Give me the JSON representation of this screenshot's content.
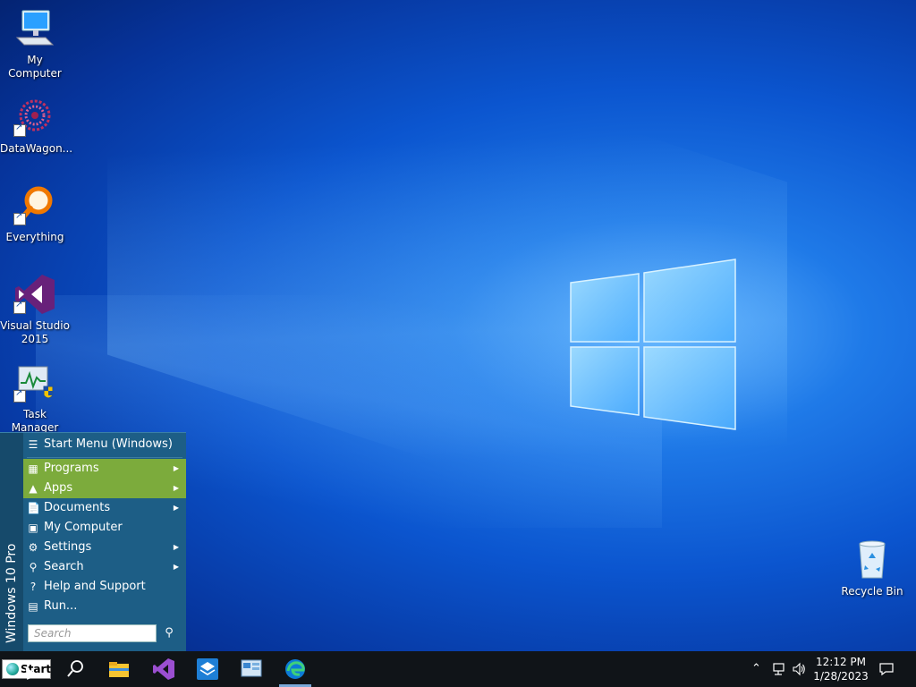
{
  "desktop": {
    "icons": [
      {
        "label": "My Computer"
      },
      {
        "label": "DataWagon..."
      },
      {
        "label": "Everything"
      },
      {
        "label": "Visual Studio 2015"
      },
      {
        "label": "Task Manager"
      },
      {
        "label": "Recycle Bin"
      }
    ]
  },
  "start_menu": {
    "sidebar_text": "Windows 10 Pro",
    "items": [
      {
        "label": "Start Menu (Windows)",
        "icon": "start-menu-icon",
        "submenu": false
      },
      {
        "label": "Programs",
        "icon": "programs-icon",
        "submenu": true
      },
      {
        "label": "Apps",
        "icon": "apps-icon",
        "submenu": true
      },
      {
        "label": "Documents",
        "icon": "documents-icon",
        "submenu": true
      },
      {
        "label": "My Computer",
        "icon": "computer-icon",
        "submenu": false
      },
      {
        "label": "Settings",
        "icon": "settings-icon",
        "submenu": true
      },
      {
        "label": "Search",
        "icon": "search-icon",
        "submenu": true
      },
      {
        "label": "Help and Support",
        "icon": "help-icon",
        "submenu": false
      },
      {
        "label": "Run...",
        "icon": "run-icon",
        "submenu": false
      }
    ],
    "search_placeholder": "Search",
    "highlight_color": "#7cab3c",
    "menu_color": "#1d5e86"
  },
  "taskbar": {
    "start_label": "Start",
    "pinned": [
      "search-icon",
      "file-explorer-icon",
      "visual-studio-icon",
      "app-icon",
      "control-panel-icon",
      "edge-icon"
    ],
    "clock": {
      "time": "12:12 PM",
      "date": "1/28/2023"
    }
  }
}
